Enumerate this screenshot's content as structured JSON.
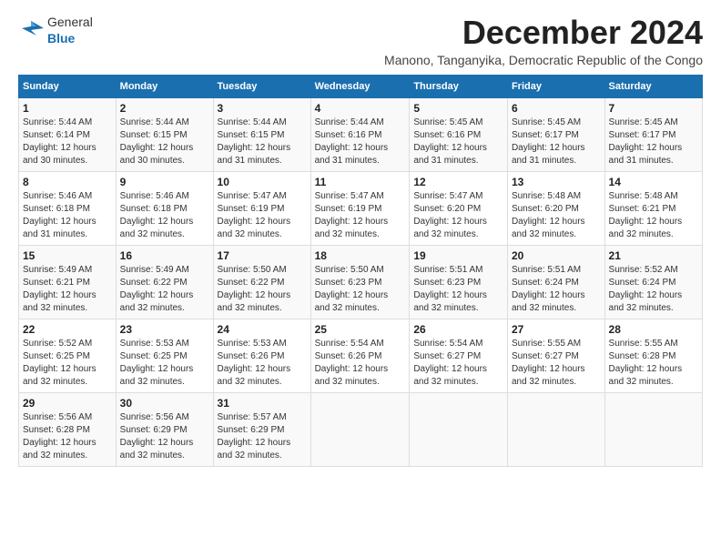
{
  "logo": {
    "general": "General",
    "blue": "Blue"
  },
  "title": "December 2024",
  "subtitle": "Manono, Tanganyika, Democratic Republic of the Congo",
  "days_of_week": [
    "Sunday",
    "Monday",
    "Tuesday",
    "Wednesday",
    "Thursday",
    "Friday",
    "Saturday"
  ],
  "weeks": [
    [
      {
        "day": "1",
        "sunrise": "5:44 AM",
        "sunset": "6:14 PM",
        "daylight": "12 hours and 30 minutes."
      },
      {
        "day": "2",
        "sunrise": "5:44 AM",
        "sunset": "6:15 PM",
        "daylight": "12 hours and 30 minutes."
      },
      {
        "day": "3",
        "sunrise": "5:44 AM",
        "sunset": "6:15 PM",
        "daylight": "12 hours and 31 minutes."
      },
      {
        "day": "4",
        "sunrise": "5:44 AM",
        "sunset": "6:16 PM",
        "daylight": "12 hours and 31 minutes."
      },
      {
        "day": "5",
        "sunrise": "5:45 AM",
        "sunset": "6:16 PM",
        "daylight": "12 hours and 31 minutes."
      },
      {
        "day": "6",
        "sunrise": "5:45 AM",
        "sunset": "6:17 PM",
        "daylight": "12 hours and 31 minutes."
      },
      {
        "day": "7",
        "sunrise": "5:45 AM",
        "sunset": "6:17 PM",
        "daylight": "12 hours and 31 minutes."
      }
    ],
    [
      {
        "day": "8",
        "sunrise": "5:46 AM",
        "sunset": "6:18 PM",
        "daylight": "12 hours and 31 minutes."
      },
      {
        "day": "9",
        "sunrise": "5:46 AM",
        "sunset": "6:18 PM",
        "daylight": "12 hours and 32 minutes."
      },
      {
        "day": "10",
        "sunrise": "5:47 AM",
        "sunset": "6:19 PM",
        "daylight": "12 hours and 32 minutes."
      },
      {
        "day": "11",
        "sunrise": "5:47 AM",
        "sunset": "6:19 PM",
        "daylight": "12 hours and 32 minutes."
      },
      {
        "day": "12",
        "sunrise": "5:47 AM",
        "sunset": "6:20 PM",
        "daylight": "12 hours and 32 minutes."
      },
      {
        "day": "13",
        "sunrise": "5:48 AM",
        "sunset": "6:20 PM",
        "daylight": "12 hours and 32 minutes."
      },
      {
        "day": "14",
        "sunrise": "5:48 AM",
        "sunset": "6:21 PM",
        "daylight": "12 hours and 32 minutes."
      }
    ],
    [
      {
        "day": "15",
        "sunrise": "5:49 AM",
        "sunset": "6:21 PM",
        "daylight": "12 hours and 32 minutes."
      },
      {
        "day": "16",
        "sunrise": "5:49 AM",
        "sunset": "6:22 PM",
        "daylight": "12 hours and 32 minutes."
      },
      {
        "day": "17",
        "sunrise": "5:50 AM",
        "sunset": "6:22 PM",
        "daylight": "12 hours and 32 minutes."
      },
      {
        "day": "18",
        "sunrise": "5:50 AM",
        "sunset": "6:23 PM",
        "daylight": "12 hours and 32 minutes."
      },
      {
        "day": "19",
        "sunrise": "5:51 AM",
        "sunset": "6:23 PM",
        "daylight": "12 hours and 32 minutes."
      },
      {
        "day": "20",
        "sunrise": "5:51 AM",
        "sunset": "6:24 PM",
        "daylight": "12 hours and 32 minutes."
      },
      {
        "day": "21",
        "sunrise": "5:52 AM",
        "sunset": "6:24 PM",
        "daylight": "12 hours and 32 minutes."
      }
    ],
    [
      {
        "day": "22",
        "sunrise": "5:52 AM",
        "sunset": "6:25 PM",
        "daylight": "12 hours and 32 minutes."
      },
      {
        "day": "23",
        "sunrise": "5:53 AM",
        "sunset": "6:25 PM",
        "daylight": "12 hours and 32 minutes."
      },
      {
        "day": "24",
        "sunrise": "5:53 AM",
        "sunset": "6:26 PM",
        "daylight": "12 hours and 32 minutes."
      },
      {
        "day": "25",
        "sunrise": "5:54 AM",
        "sunset": "6:26 PM",
        "daylight": "12 hours and 32 minutes."
      },
      {
        "day": "26",
        "sunrise": "5:54 AM",
        "sunset": "6:27 PM",
        "daylight": "12 hours and 32 minutes."
      },
      {
        "day": "27",
        "sunrise": "5:55 AM",
        "sunset": "6:27 PM",
        "daylight": "12 hours and 32 minutes."
      },
      {
        "day": "28",
        "sunrise": "5:55 AM",
        "sunset": "6:28 PM",
        "daylight": "12 hours and 32 minutes."
      }
    ],
    [
      {
        "day": "29",
        "sunrise": "5:56 AM",
        "sunset": "6:28 PM",
        "daylight": "12 hours and 32 minutes."
      },
      {
        "day": "30",
        "sunrise": "5:56 AM",
        "sunset": "6:29 PM",
        "daylight": "12 hours and 32 minutes."
      },
      {
        "day": "31",
        "sunrise": "5:57 AM",
        "sunset": "6:29 PM",
        "daylight": "12 hours and 32 minutes."
      },
      null,
      null,
      null,
      null
    ]
  ],
  "labels": {
    "sunrise": "Sunrise:",
    "sunset": "Sunset:",
    "daylight": "Daylight:"
  }
}
